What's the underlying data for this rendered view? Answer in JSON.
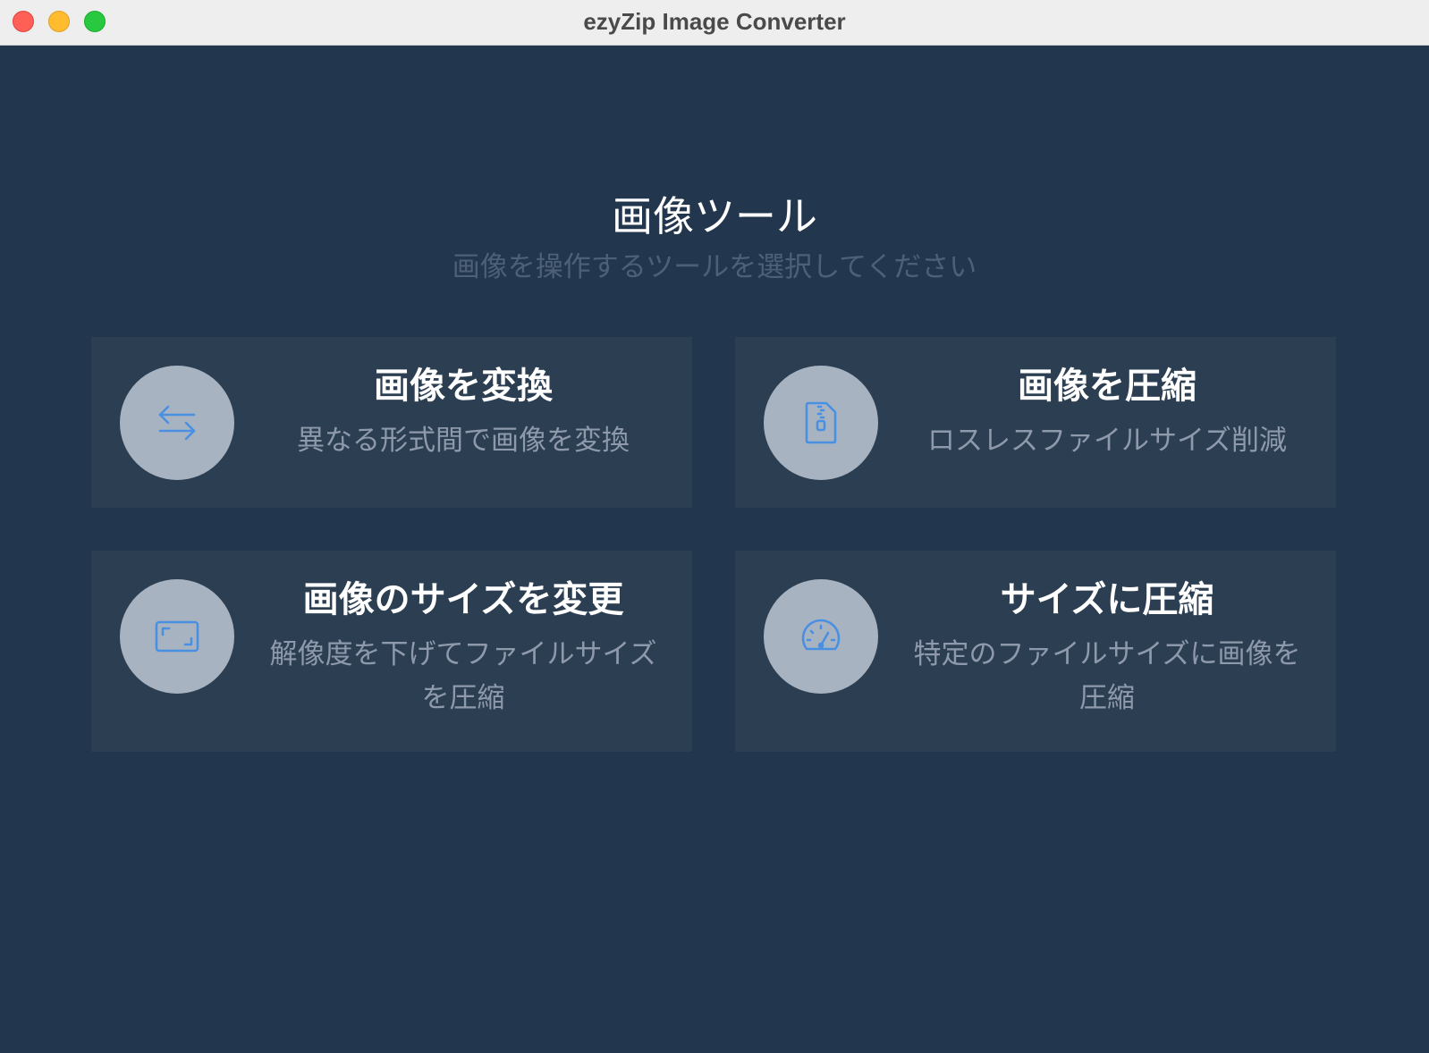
{
  "window": {
    "title": "ezyZip Image Converter"
  },
  "header": {
    "title": "画像ツール",
    "subtitle": "画像を操作するツールを選択してください"
  },
  "tools": [
    {
      "title": "画像を変換",
      "description": "異なる形式間で画像を変換",
      "icon": "convert-arrows-icon"
    },
    {
      "title": "画像を圧縮",
      "description": "ロスレスファイルサイズ削減",
      "icon": "zip-file-icon"
    },
    {
      "title": "画像のサイズを変更",
      "description": "解像度を下げてファイルサイズを圧縮",
      "icon": "resize-frame-icon"
    },
    {
      "title": "サイズに圧縮",
      "description": "特定のファイルサイズに画像を圧縮",
      "icon": "speedometer-icon"
    }
  ],
  "colors": {
    "background": "#22364d",
    "card": "#2c3e52",
    "icon_circle": "#a8b3c1",
    "icon_stroke": "#4a90e2",
    "title_text": "#ffffff",
    "description_text": "#8e9aab"
  }
}
